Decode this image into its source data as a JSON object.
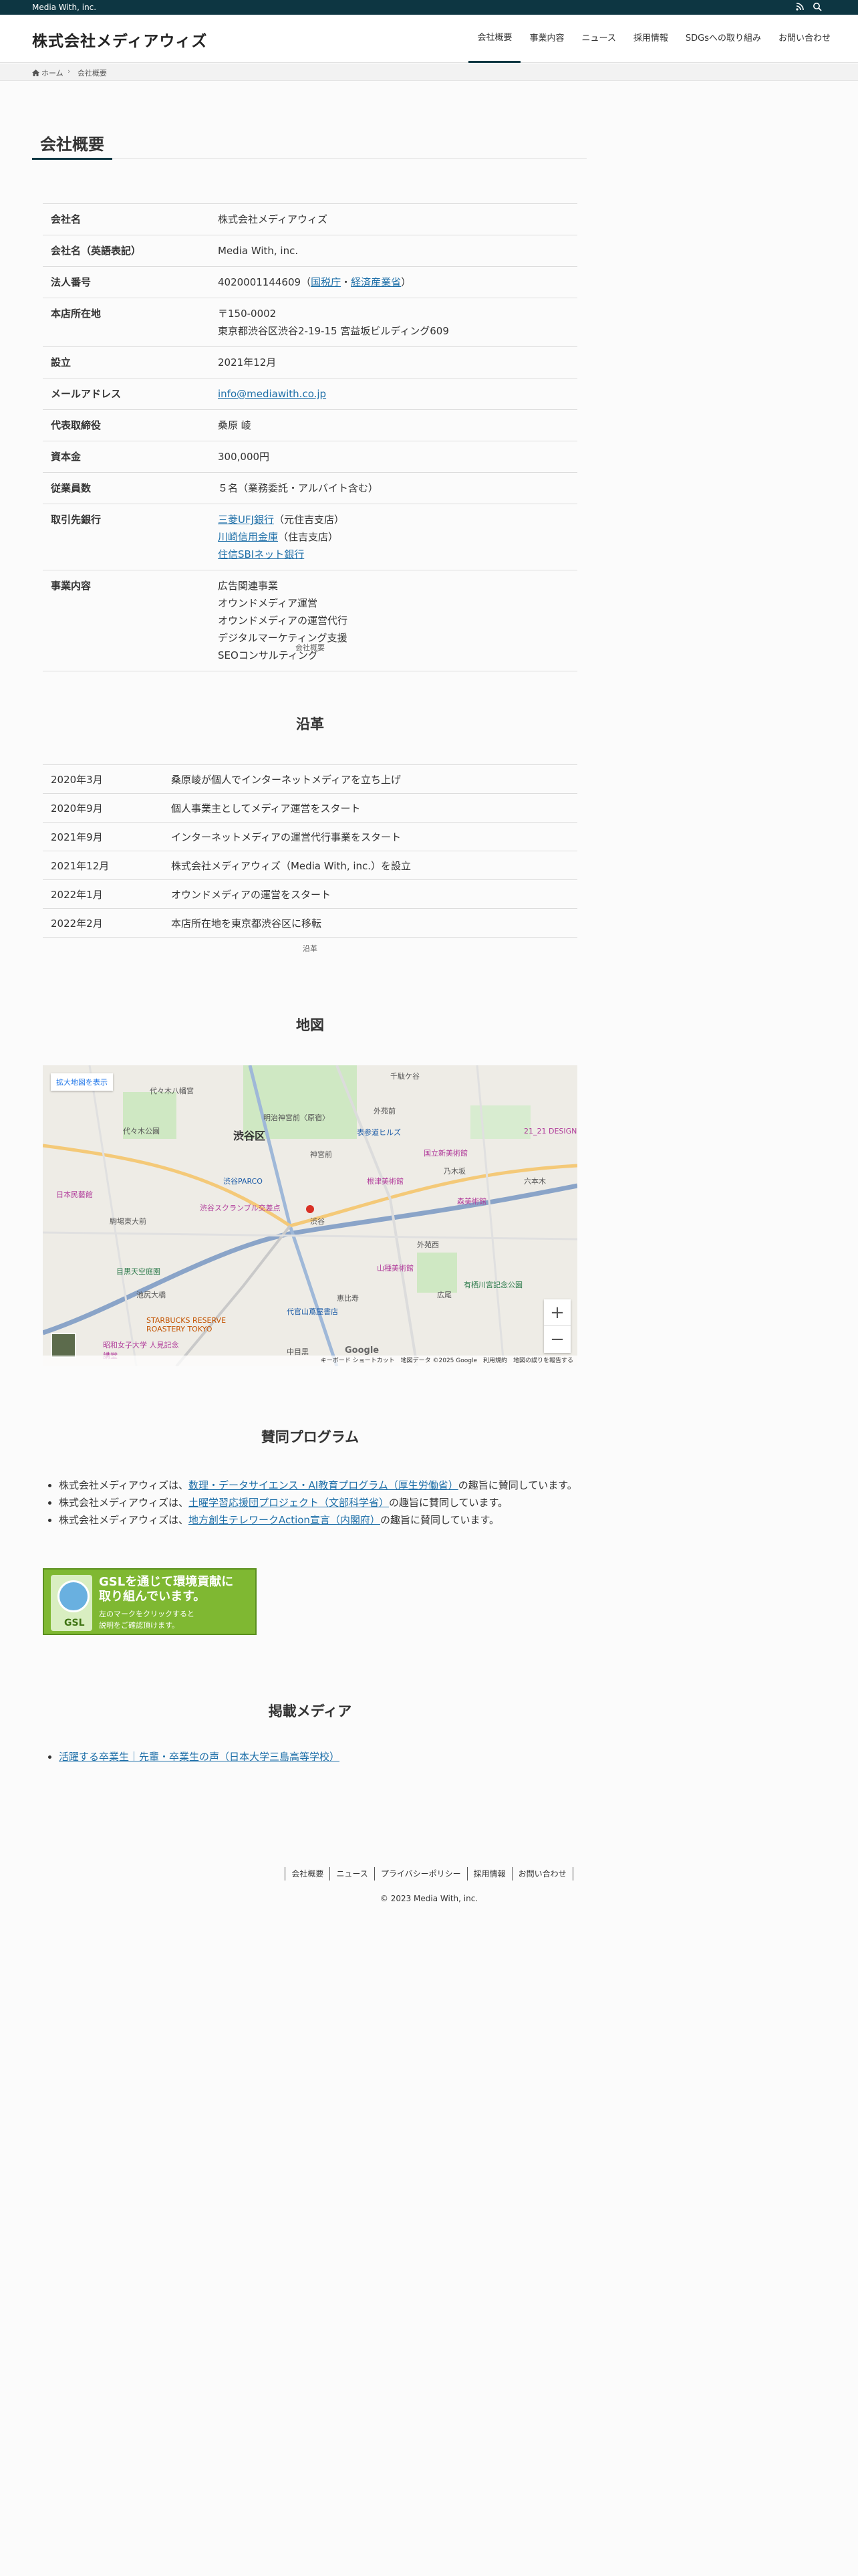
{
  "topbar": {
    "tagline": "Media With, inc.",
    "rss_icon": "rss-icon",
    "search_icon": "search-icon"
  },
  "header": {
    "logo": "株式会社メディアウィズ",
    "nav": [
      "会社概要",
      "事業内容",
      "ニュース",
      "採用情報",
      "SDGsへの取り組み",
      "お問い合わせ"
    ]
  },
  "breadcrumb": {
    "home": "ホーム",
    "current": "会社概要"
  },
  "page_title": "会社概要",
  "company": {
    "rows": [
      {
        "k": "会社名",
        "v": "株式会社メディアウィズ"
      },
      {
        "k": "会社名（英語表記）",
        "v": "Media With, inc."
      },
      {
        "k": "法人番号",
        "v": "4020001144609（",
        "link1": "国税庁",
        "mid": "・",
        "link2": "経済産業省",
        "end": "）"
      },
      {
        "k": "本店所在地",
        "v1": "〒150-0002",
        "v2": "東京都渋谷区渋谷2-19-15 宮益坂ビルディング609"
      },
      {
        "k": "設立",
        "v": "2021年12月"
      },
      {
        "k": "メールアドレス",
        "v": "info@mediawith.co.jp"
      },
      {
        "k": "代表取締役",
        "v": "桑原 崚"
      },
      {
        "k": "資本金",
        "v": "300,000円"
      },
      {
        "k": "従業員数",
        "v": "５名（業務委託・アルバイト含む）"
      },
      {
        "k": "取引先銀行",
        "b1": "三菱UFJ銀行",
        "b1s": "（元住吉支店）",
        "b2": "川崎信用金庫",
        "b2s": "（住吉支店）",
        "b3": "住信SBIネット銀行"
      },
      {
        "k": "事業内容",
        "l1": "広告関連事業",
        "l2": "オウンドメディア運営",
        "l3": "オウンドメディアの運営代行",
        "l4": "デジタルマーケティング支援",
        "l5": "SEOコンサルティング"
      }
    ],
    "caption": "会社概要"
  },
  "history": {
    "title": "沿革",
    "caption": "沿革",
    "rows": [
      {
        "d": "2020年3月",
        "e": "桑原崚が個人でインターネットメディアを立ち上げ"
      },
      {
        "d": "2020年9月",
        "e": "個人事業主としてメディア運営をスタート"
      },
      {
        "d": "2021年9月",
        "e": "インターネットメディアの運営代行事業をスタート"
      },
      {
        "d": "2021年12月",
        "e": "株式会社メディアウィズ（Media With, inc.）を設立"
      },
      {
        "d": "2022年1月",
        "e": "オウンドメディアの運営をスタート"
      },
      {
        "d": "2022年2月",
        "e": "本店所在地を東京都渋谷区に移転"
      }
    ]
  },
  "map": {
    "title": "地図",
    "enlarge": "拡大地図を表示",
    "zoom_in": "+",
    "zoom_out": "−",
    "google": "Google",
    "footer": "キーボード ショートカット　地図データ ©2025 Google　利用規約　地図の誤りを報告する",
    "labels": [
      "代々木八幡宮",
      "代々木公園",
      "渋谷区",
      "明治神宮前〈原宿〉",
      "表参道ヒルズ",
      "国立新美術館",
      "21_21 DESIGN",
      "渋谷PARCO",
      "根津美術館",
      "日本民藝館",
      "渋谷スクランブル交差点",
      "駒場東大前",
      "渋谷",
      "六本木",
      "森美術館",
      "目黒天空庭園",
      "山種美術館",
      "有栖川宮記念公園",
      "池尻大橋",
      "広尾",
      "恵比寿",
      "代官山蔦屋書店",
      "STARBUCKS RESERVE ROASTERY TOKYO",
      "昭和女子大学 人見記念講堂",
      "中目黒",
      "外苑前",
      "千駄ケ谷",
      "神宮前",
      "乃木坂",
      "外苑西"
    ]
  },
  "support": {
    "title": "賛同プログラム",
    "items": [
      {
        "pre": "株式会社メディアウィズは、",
        "link": "数理・データサイエンス・AI教育プログラム（厚生労働省）",
        "post": "の趣旨に賛同しています。"
      },
      {
        "pre": "株式会社メディアウィズは、",
        "link": "土曜学習応援団プロジェクト（文部科学省）",
        "post": "の趣旨に賛同しています。"
      },
      {
        "pre": "株式会社メディアウィズは、",
        "link": "地方創生テレワークAction宣言（内閣府）",
        "post": "の趣旨に賛同しています。"
      }
    ],
    "gsl": {
      "line1": "GSLを通じて環境貢献に",
      "line2": "取り組んでいます。",
      "line3": "左のマークをクリックすると",
      "line4": "説明をご確認頂けます。",
      "badge": "GSL"
    }
  },
  "media": {
    "title": "掲載メディア",
    "link": "活躍する卒業生｜先輩・卒業生の声（日本大学三島高等学校）"
  },
  "footer": {
    "nav": [
      "会社概要",
      "ニュース",
      "プライバシーポリシー",
      "採用情報",
      "お問い合わせ"
    ],
    "copyright": "© 2023 Media With, inc."
  }
}
